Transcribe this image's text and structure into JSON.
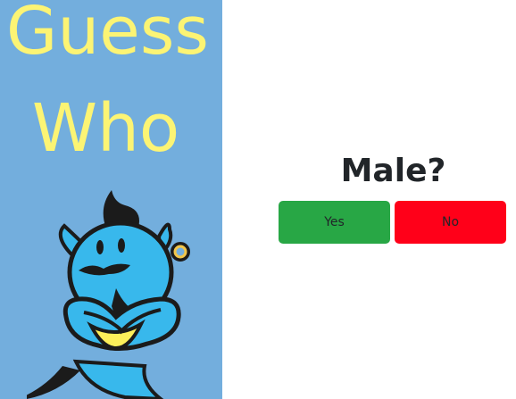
{
  "banner": {
    "title_line1": "Guess",
    "title_line2": "Who",
    "title_color": "#fcf474",
    "background_color": "#73aedd",
    "mascot_icon": "genie-mascot-icon"
  },
  "question": {
    "text": "Male?"
  },
  "answers": {
    "yes_label": "Yes",
    "no_label": "No",
    "yes_color": "#28a745",
    "no_color": "#ff0019"
  }
}
